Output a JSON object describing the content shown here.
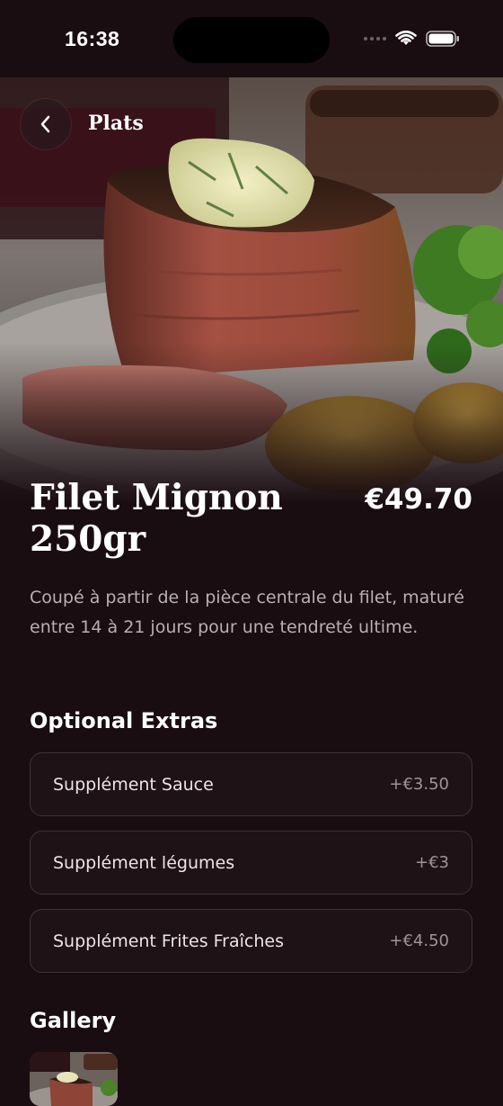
{
  "status_bar": {
    "time": "16:38"
  },
  "nav": {
    "back_icon": "chevron-left-icon",
    "title": "Plats"
  },
  "dish": {
    "name": "Filet Mignon 250gr",
    "price": "€49.70",
    "description": "Coupé à partir de la pièce centrale du filet, maturé entre 14 à 21 jours pour une tendreté ultime."
  },
  "extras": {
    "heading": "Optional Extras",
    "items": [
      {
        "name": "Supplément Sauce",
        "price": "+€3.50"
      },
      {
        "name": "Supplément légumes",
        "price": "+€3"
      },
      {
        "name": "Supplément Frites Fraîches",
        "price": "+€4.50"
      }
    ]
  },
  "gallery": {
    "heading": "Gallery"
  },
  "colors": {
    "background": "#1a0d12",
    "card_border": "#3f3137",
    "text_primary": "#ffffff",
    "text_secondary": "#b9afb3"
  }
}
